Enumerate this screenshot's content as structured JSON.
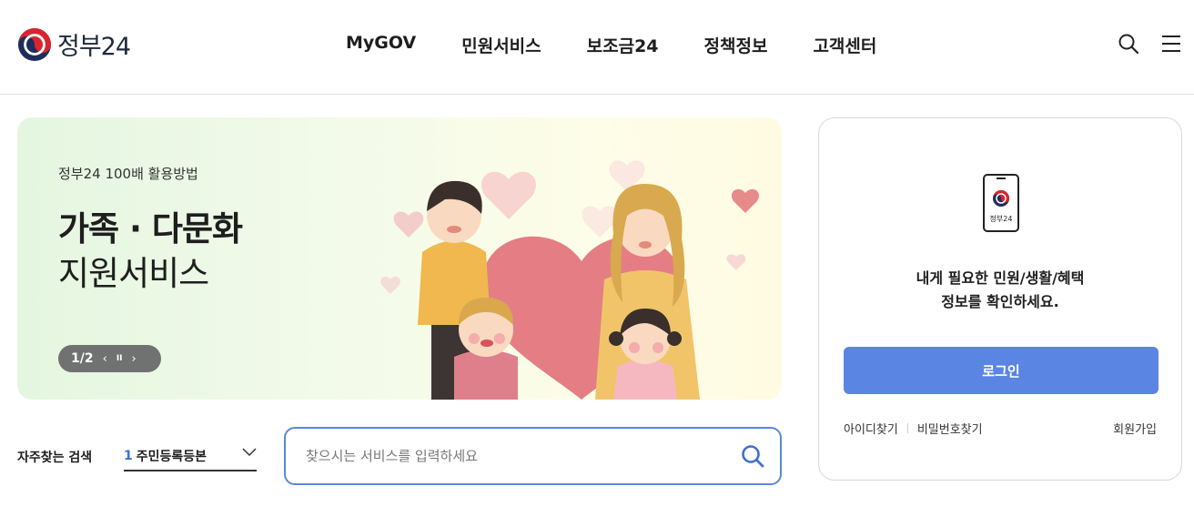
{
  "header": {
    "logo_text": "정부24",
    "nav": [
      "MyGOV",
      "민원서비스",
      "보조금24",
      "정책정보",
      "고객센터"
    ],
    "icons": [
      "search-icon",
      "menu-icon"
    ]
  },
  "banner": {
    "subtitle": "정부24 100배 활용방법",
    "title_line1": "가족 · 다문화",
    "title_line2": "지원서비스",
    "counter": "1/2",
    "prev_label": "‹",
    "pause_label": "II",
    "next_label": "›"
  },
  "frequent": {
    "label": "자주찾는 검색",
    "selected_number": "1",
    "selected_text": "주민등록등본"
  },
  "search": {
    "placeholder": "찾으시는 서비스를 입력하세요"
  },
  "login": {
    "phone_label": "정부24",
    "message_line1": "내게 필요한 민원/생활/혜택",
    "message_line2": "정보를 확인하세요.",
    "button": "로그인",
    "find_id": "아이디찾기",
    "find_pw": "비밀번호찾기",
    "signup": "회원가입"
  },
  "colors": {
    "accent": "#5b85e2",
    "search_border": "#5d86d8",
    "banner_bg": "#eef9e6"
  }
}
